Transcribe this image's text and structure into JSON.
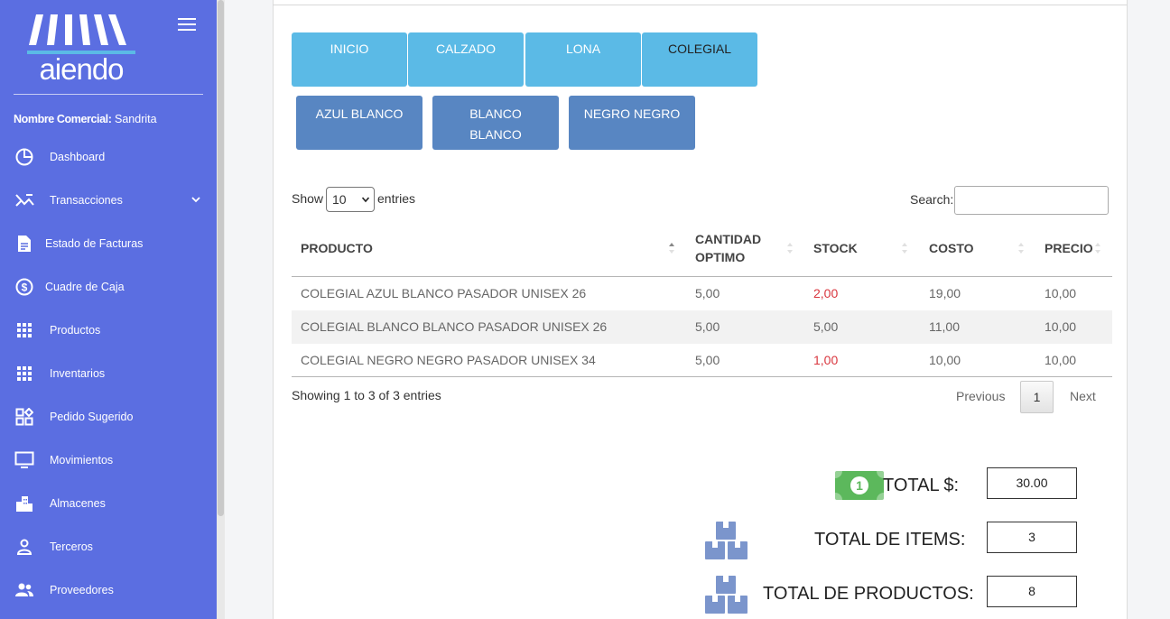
{
  "sidebar": {
    "logo_text": "aiendo",
    "commercial_label": "Nombre Comercial:",
    "commercial_name": "Sandrita",
    "items": [
      {
        "label": "Dashboard",
        "icon": "pie-chart-icon"
      },
      {
        "label": "Transacciones",
        "icon": "transactions-icon"
      },
      {
        "label": "Estado de Facturas",
        "icon": "document-icon"
      },
      {
        "label": "Cuadre de Caja",
        "icon": "dollar-circle-icon"
      },
      {
        "label": "Productos",
        "icon": "grid-icon"
      },
      {
        "label": "Inventarios",
        "icon": "grid-icon"
      },
      {
        "label": "Pedido Sugerido",
        "icon": "widgets-icon"
      },
      {
        "label": "Movimientos",
        "icon": "monitor-icon"
      },
      {
        "label": "Almacenes",
        "icon": "buildings-icon"
      },
      {
        "label": "Terceros",
        "icon": "person-icon"
      },
      {
        "label": "Proveedores",
        "icon": "people-icon"
      }
    ]
  },
  "categories": [
    "INICIO",
    "CALZADO",
    "LONA",
    "COLEGIAL"
  ],
  "subcategories": [
    "AZUL BLANCO",
    "BLANCO BLANCO",
    "NEGRO NEGRO"
  ],
  "table": {
    "show_label": "Show",
    "entries_label": "entries",
    "page_length": "10",
    "search_label": "Search:",
    "search_value": "",
    "columns": [
      "PRODUCTO",
      "CANTIDAD OPTIMO",
      "STOCK",
      "COSTO",
      "PRECIO"
    ],
    "rows": [
      {
        "producto": "COLEGIAL AZUL BLANCO PASADOR UNISEX 26",
        "cantidad": "5,00",
        "stock": "2,00",
        "costo": "19,00",
        "precio": "10,00"
      },
      {
        "producto": "COLEGIAL BLANCO BLANCO PASADOR UNISEX 26",
        "cantidad": "5,00",
        "stock": "5,00",
        "costo": "11,00",
        "precio": "10,00"
      },
      {
        "producto": "COLEGIAL NEGRO NEGRO PASADOR UNISEX 34",
        "cantidad": "5,00",
        "stock": "1,00",
        "costo": "10,00",
        "precio": "10,00"
      }
    ],
    "info": "Showing 1 to 3 of 3 entries",
    "previous": "Previous",
    "current_page": "1",
    "next": "Next"
  },
  "totals": {
    "total_money_label": "TOTAL $:",
    "total_money_value": "30.00",
    "total_items_label": "TOTAL DE ITEMS:",
    "total_items_value": "3",
    "total_products_label": "TOTAL DE PRODUCTOS:",
    "total_products_value": "8"
  },
  "colors": {
    "sidebar": "#5b6ee1",
    "category_button": "#5bbae6",
    "subcategory_button": "#5886c2",
    "low_stock": "#d9363e",
    "money_icon": "#5cb85c",
    "boxes_icon": "#7b95cc"
  }
}
